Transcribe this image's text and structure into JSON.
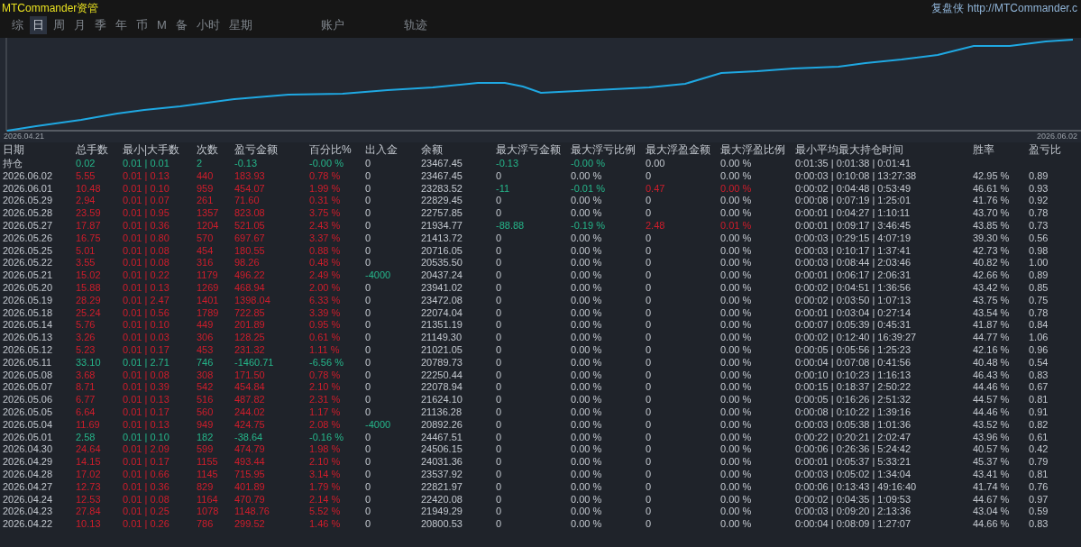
{
  "app": {
    "title": "MTCommander资管",
    "brand": "复盘侠",
    "link": "http://MTCommander.c"
  },
  "tabs": [
    {
      "label": "综",
      "selected": false
    },
    {
      "label": "日",
      "selected": true
    },
    {
      "label": "周",
      "selected": false
    },
    {
      "label": "月",
      "selected": false
    },
    {
      "label": "季",
      "selected": false
    },
    {
      "label": "年",
      "selected": false
    },
    {
      "label": "币",
      "selected": false
    },
    {
      "label": "M",
      "selected": false
    },
    {
      "label": "备",
      "selected": false
    },
    {
      "label": "小时",
      "selected": false
    },
    {
      "label": "星期",
      "selected": false
    },
    {
      "label": "账户",
      "selected": false
    },
    {
      "label": "轨迹",
      "selected": false
    }
  ],
  "chart": {
    "start_label": "2026.04.21",
    "end_label": "2026.06.02"
  },
  "table": {
    "columns": [
      "日期",
      "总手数",
      "最小|大手数",
      "次数",
      "盈亏金额",
      "百分比%",
      "出入金",
      "余额",
      "最大浮亏金额",
      "最大浮亏比例",
      "最大浮盈金额",
      "最大浮盈比例",
      "最小平均最大持仓时间",
      "胜率",
      "盈亏比"
    ],
    "rows": [
      {
        "profit": false,
        "drawdown_marked": true,
        "cells": [
          "持仓",
          "0.02",
          "0.01 | 0.01",
          "2",
          "-0.13",
          "-0.00 %",
          "0",
          "23467.45",
          "-0.13",
          "-0.00 %",
          "0.00",
          "0.00 %",
          "0:01:35 | 0:01:38 | 0:01:41"
        ]
      },
      {
        "profit": true,
        "cells": [
          "2026.06.02",
          "5.55",
          "0.01 | 0.13",
          "440",
          "183.93",
          "0.78 %",
          "0",
          "23467.45",
          "0",
          "0.00 %",
          "0",
          "0.00 %",
          "0:00:03 | 0:10:08 | 13:27:38",
          "42.95 %",
          "0.89"
        ]
      },
      {
        "profit": true,
        "drawdown_marked": true,
        "runup_marked": true,
        "cells": [
          "2026.06.01",
          "10.48",
          "0.01 | 0.10",
          "959",
          "454.07",
          "1.99 %",
          "0",
          "23283.52",
          "-11",
          "-0.01 %",
          "0.47",
          "0.00 %",
          "0:00:02 | 0:04:48 | 0:53:49",
          "46.61 %",
          "0.93"
        ]
      },
      {
        "profit": true,
        "cells": [
          "2026.05.29",
          "2.94",
          "0.01 | 0.07",
          "261",
          "71.60",
          "0.31 %",
          "0",
          "22829.45",
          "0",
          "0.00 %",
          "0",
          "0.00 %",
          "0:00:08 | 0:07:19 | 1:25:01",
          "41.76 %",
          "0.92"
        ]
      },
      {
        "profit": true,
        "cells": [
          "2026.05.28",
          "23.59",
          "0.01 | 0.95",
          "1357",
          "823.08",
          "3.75 %",
          "0",
          "22757.85",
          "0",
          "0.00 %",
          "0",
          "0.00 %",
          "0:00:01 | 0:04:27 | 1:10:11",
          "43.70 %",
          "0.78"
        ]
      },
      {
        "profit": true,
        "drawdown_marked": true,
        "runup_marked": true,
        "cells": [
          "2026.05.27",
          "17.87",
          "0.01 | 0.36",
          "1204",
          "521.05",
          "2.43 %",
          "0",
          "21934.77",
          "-88.88",
          "-0.19 %",
          "2.48",
          "0.01 %",
          "0:00:01 | 0:09:17 | 3:46:45",
          "43.85 %",
          "0.73"
        ]
      },
      {
        "profit": true,
        "cells": [
          "2026.05.26",
          "16.75",
          "0.01 | 0.80",
          "570",
          "697.67",
          "3.37 %",
          "0",
          "21413.72",
          "0",
          "0.00 %",
          "0",
          "0.00 %",
          "0:00:03 | 0:29:15 | 4:07:19",
          "39.30 %",
          "0.56"
        ]
      },
      {
        "profit": true,
        "cells": [
          "2026.05.25",
          "5.01",
          "0.01 | 0.08",
          "454",
          "180.55",
          "0.88 %",
          "0",
          "20716.05",
          "0",
          "0.00 %",
          "0",
          "0.00 %",
          "0:00:03 | 0:10:17 | 1:37:41",
          "42.73 %",
          "0.98"
        ]
      },
      {
        "profit": true,
        "cells": [
          "2026.05.22",
          "3.55",
          "0.01 | 0.08",
          "316",
          "98.26",
          "0.48 %",
          "0",
          "20535.50",
          "0",
          "0.00 %",
          "0",
          "0.00 %",
          "0:00:03 | 0:08:44 | 2:03:46",
          "40.82 %",
          "1.00"
        ]
      },
      {
        "profit": true,
        "flow_marked": true,
        "cells": [
          "2026.05.21",
          "15.02",
          "0.01 | 0.22",
          "1179",
          "496.22",
          "2.49 %",
          "-4000",
          "20437.24",
          "0",
          "0.00 %",
          "0",
          "0.00 %",
          "0:00:01 | 0:06:17 | 2:06:31",
          "42.66 %",
          "0.89"
        ]
      },
      {
        "profit": true,
        "cells": [
          "2026.05.20",
          "15.88",
          "0.01 | 0.13",
          "1269",
          "468.94",
          "2.00 %",
          "0",
          "23941.02",
          "0",
          "0.00 %",
          "0",
          "0.00 %",
          "0:00:02 | 0:04:51 | 1:36:56",
          "43.42 %",
          "0.85"
        ]
      },
      {
        "profit": true,
        "cells": [
          "2026.05.19",
          "28.29",
          "0.01 | 2.47",
          "1401",
          "1398.04",
          "6.33 %",
          "0",
          "23472.08",
          "0",
          "0.00 %",
          "0",
          "0.00 %",
          "0:00:02 | 0:03:50 | 1:07:13",
          "43.75 %",
          "0.75"
        ]
      },
      {
        "profit": true,
        "cells": [
          "2026.05.18",
          "25.24",
          "0.01 | 0.56",
          "1789",
          "722.85",
          "3.39 %",
          "0",
          "22074.04",
          "0",
          "0.00 %",
          "0",
          "0.00 %",
          "0:00:01 | 0:03:04 | 0:27:14",
          "43.54 %",
          "0.78"
        ]
      },
      {
        "profit": true,
        "cells": [
          "2026.05.14",
          "5.76",
          "0.01 | 0.10",
          "449",
          "201.89",
          "0.95 %",
          "0",
          "21351.19",
          "0",
          "0.00 %",
          "0",
          "0.00 %",
          "0:00:07 | 0:05:39 | 0:45:31",
          "41.87 %",
          "0.84"
        ]
      },
      {
        "profit": true,
        "cells": [
          "2026.05.13",
          "3.26",
          "0.01 | 0.03",
          "306",
          "128.25",
          "0.61 %",
          "0",
          "21149.30",
          "0",
          "0.00 %",
          "0",
          "0.00 %",
          "0:00:02 | 0:12:40 | 16:39:27",
          "44.77 %",
          "1.06"
        ]
      },
      {
        "profit": true,
        "cells": [
          "2026.05.12",
          "5.23",
          "0.01 | 0.17",
          "453",
          "231.32",
          "1.11 %",
          "0",
          "21021.05",
          "0",
          "0.00 %",
          "0",
          "0.00 %",
          "0:00:05 | 0:05:56 | 1:25:23",
          "42.16 %",
          "0.96"
        ]
      },
      {
        "profit": false,
        "cells": [
          "2026.05.11",
          "33.10",
          "0.01 | 2.71",
          "746",
          "-1460.71",
          "-6.56 %",
          "0",
          "20789.73",
          "0",
          "0.00 %",
          "0",
          "0.00 %",
          "0:00:04 | 0:07:08 | 0:41:56",
          "40.48 %",
          "0.54"
        ]
      },
      {
        "profit": true,
        "cells": [
          "2026.05.08",
          "3.68",
          "0.01 | 0.08",
          "308",
          "171.50",
          "0.78 %",
          "0",
          "22250.44",
          "0",
          "0.00 %",
          "0",
          "0.00 %",
          "0:00:10 | 0:10:23 | 1:16:13",
          "46.43 %",
          "0.83"
        ]
      },
      {
        "profit": true,
        "cells": [
          "2026.05.07",
          "8.71",
          "0.01 | 0.39",
          "542",
          "454.84",
          "2.10 %",
          "0",
          "22078.94",
          "0",
          "0.00 %",
          "0",
          "0.00 %",
          "0:00:15 | 0:18:37 | 2:50:22",
          "44.46 %",
          "0.67"
        ]
      },
      {
        "profit": true,
        "cells": [
          "2026.05.06",
          "6.77",
          "0.01 | 0.13",
          "516",
          "487.82",
          "2.31 %",
          "0",
          "21624.10",
          "0",
          "0.00 %",
          "0",
          "0.00 %",
          "0:00:05 | 0:16:26 | 2:51:32",
          "44.57 %",
          "0.81"
        ]
      },
      {
        "profit": true,
        "cells": [
          "2026.05.05",
          "6.64",
          "0.01 | 0.17",
          "560",
          "244.02",
          "1.17 %",
          "0",
          "21136.28",
          "0",
          "0.00 %",
          "0",
          "0.00 %",
          "0:00:08 | 0:10:22 | 1:39:16",
          "44.46 %",
          "0.91"
        ]
      },
      {
        "profit": true,
        "flow_marked": true,
        "cells": [
          "2026.05.04",
          "11.69",
          "0.01 | 0.13",
          "949",
          "424.75",
          "2.08 %",
          "-4000",
          "20892.26",
          "0",
          "0.00 %",
          "0",
          "0.00 %",
          "0:00:03 | 0:05:38 | 1:01:36",
          "43.52 %",
          "0.82"
        ]
      },
      {
        "profit": false,
        "cells": [
          "2026.05.01",
          "2.58",
          "0.01 | 0.10",
          "182",
          "-38.64",
          "-0.16 %",
          "0",
          "24467.51",
          "0",
          "0.00 %",
          "0",
          "0.00 %",
          "0:00:22 | 0:20:21 | 2:02:47",
          "43.96 %",
          "0.61"
        ]
      },
      {
        "profit": true,
        "cells": [
          "2026.04.30",
          "24.64",
          "0.01 | 2.09",
          "599",
          "474.79",
          "1.98 %",
          "0",
          "24506.15",
          "0",
          "0.00 %",
          "0",
          "0.00 %",
          "0:00:06 | 0:26:36 | 5:24:42",
          "40.57 %",
          "0.42"
        ]
      },
      {
        "profit": true,
        "cells": [
          "2026.04.29",
          "14.15",
          "0.01 | 0.17",
          "1155",
          "493.44",
          "2.10 %",
          "0",
          "24031.36",
          "0",
          "0.00 %",
          "0",
          "0.00 %",
          "0:00:01 | 0:05:37 | 5:33:21",
          "45.37 %",
          "0.79"
        ]
      },
      {
        "profit": true,
        "cells": [
          "2026.04.28",
          "17.02",
          "0.01 | 0.66",
          "1145",
          "715.95",
          "3.14 %",
          "0",
          "23537.92",
          "0",
          "0.00 %",
          "0",
          "0.00 %",
          "0:00:03 | 0:05:02 | 1:34:04",
          "43.41 %",
          "0.81"
        ]
      },
      {
        "profit": true,
        "cells": [
          "2026.04.27",
          "12.73",
          "0.01 | 0.36",
          "829",
          "401.89",
          "1.79 %",
          "0",
          "22821.97",
          "0",
          "0.00 %",
          "0",
          "0.00 %",
          "0:00:06 | 0:13:43 | 49:16:40",
          "41.74 %",
          "0.76"
        ]
      },
      {
        "profit": true,
        "cells": [
          "2026.04.24",
          "12.53",
          "0.01 | 0.08",
          "1164",
          "470.79",
          "2.14 %",
          "0",
          "22420.08",
          "0",
          "0.00 %",
          "0",
          "0.00 %",
          "0:00:02 | 0:04:35 | 1:09:53",
          "44.67 %",
          "0.97"
        ]
      },
      {
        "profit": true,
        "cells": [
          "2026.04.23",
          "27.84",
          "0.01 | 0.25",
          "1078",
          "1148.76",
          "5.52 %",
          "0",
          "21949.29",
          "0",
          "0.00 %",
          "0",
          "0.00 %",
          "0:00:03 | 0:09:20 | 2:13:36",
          "43.04 %",
          "0.59"
        ]
      },
      {
        "profit": true,
        "cells": [
          "2026.04.22",
          "10.13",
          "0.01 | 0.26",
          "786",
          "299.52",
          "1.46 %",
          "0",
          "20800.53",
          "0",
          "0.00 %",
          "0",
          "0.00 %",
          "0:00:04 | 0:08:09 | 1:27:07",
          "44.66 %",
          "0.83"
        ]
      }
    ]
  }
}
